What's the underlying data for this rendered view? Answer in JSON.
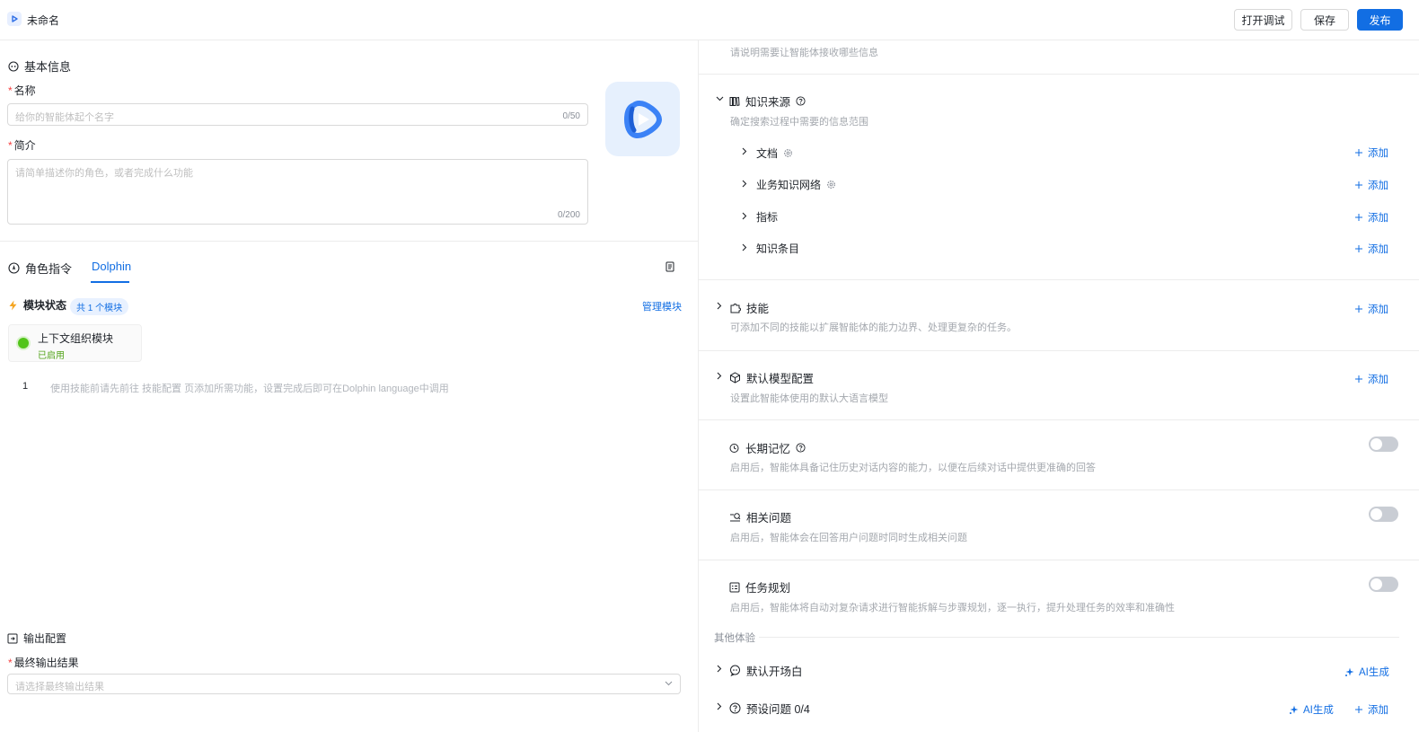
{
  "header": {
    "title": "未命名",
    "buttons": {
      "debug": "打开调试",
      "save": "保存",
      "publish": "发布"
    }
  },
  "basic_info": {
    "section_title": "基本信息",
    "name_label": "名称",
    "name_placeholder": "给你的智能体起个名字",
    "name_counter": "0/50",
    "intro_label": "简介",
    "intro_placeholder": "请简单描述你的角色，或者完成什么功能",
    "intro_counter": "0/200"
  },
  "instruction_tabs": {
    "tabs": [
      {
        "label": "角色指令"
      },
      {
        "label": "Dolphin"
      }
    ],
    "active": "Dolphin"
  },
  "module_status": {
    "title": "模块状态",
    "badge": "共 1 个模块",
    "manage_link": "管理模块",
    "modules": [
      {
        "name": "上下文组织模块",
        "status": "已启用",
        "status_color": "#52c41a"
      }
    ],
    "code_lines": [
      {
        "num": "1",
        "text": "使用技能前请先前往 技能配置 页添加所需功能，设置完成后即可在Dolphin language中调用"
      }
    ]
  },
  "output_config": {
    "section_title": "输出配置",
    "final_label": "最终输出结果",
    "final_placeholder": "请选择最终输出结果"
  },
  "right": {
    "top_desc": "请说明需要让智能体接收哪些信息",
    "knowledge": {
      "title": "知识来源",
      "desc": "确定搜索过程中需要的信息范围",
      "items": [
        {
          "label": "文档",
          "action": "添加"
        },
        {
          "label": "业务知识网络",
          "action": "添加"
        },
        {
          "label": "指标",
          "action": "添加"
        },
        {
          "label": "知识条目",
          "action": "添加"
        }
      ]
    },
    "skills": {
      "title": "技能",
      "desc": "可添加不同的技能以扩展智能体的能力边界、处理更复杂的任务。",
      "action": "添加"
    },
    "model": {
      "title": "默认模型配置",
      "desc": "设置此智能体使用的默认大语言模型",
      "action": "添加"
    },
    "memory": {
      "title": "长期记忆",
      "desc": "启用后，智能体具备记住历史对话内容的能力，以便在后续对话中提供更准确的回答"
    },
    "related": {
      "title": "相关问题",
      "desc": "启用后，智能体会在回答用户问题时同时生成相关问题"
    },
    "planning": {
      "title": "任务规划",
      "desc": "启用后，智能体将自动对复杂请求进行智能拆解与步骤规划，逐一执行，提升处理任务的效率和准确性"
    },
    "other_label": "其他体验",
    "opening": {
      "title": "默认开场白",
      "ai_action": "AI生成"
    },
    "preset": {
      "title": "预设问题 0/4",
      "ai_action": "AI生成",
      "action": "添加"
    }
  },
  "colors": {
    "primary": "#126ee3",
    "required": "#f53f3f",
    "enabled": "#52c41a"
  }
}
